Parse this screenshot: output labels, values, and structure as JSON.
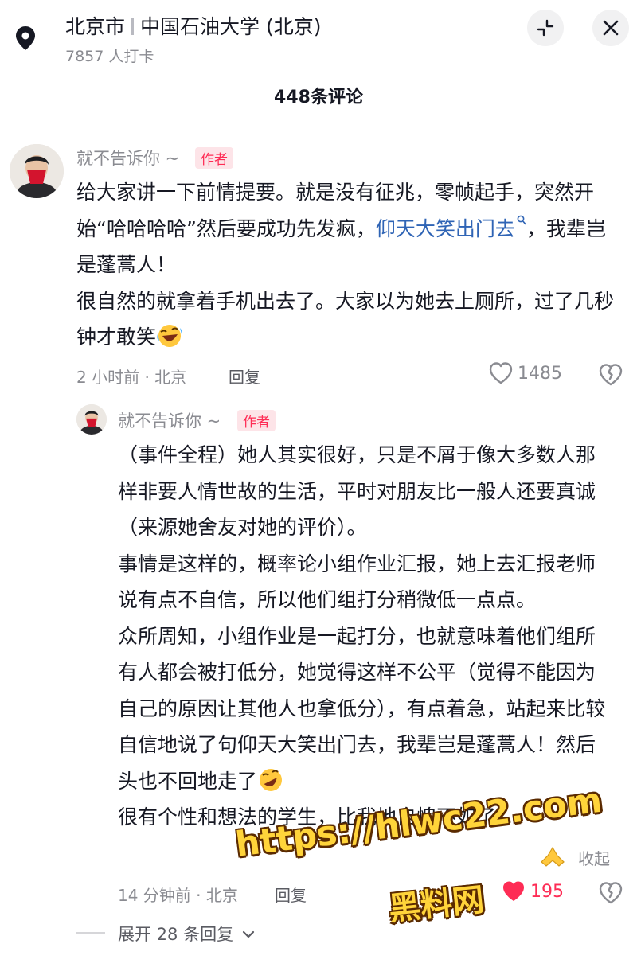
{
  "header": {
    "city": "北京市",
    "place": "中国石油大学 (北京)",
    "checkins": "7857 人打卡",
    "icons": {
      "location": "location-pin-icon",
      "collapse": "collapse-icon",
      "close": "close-icon"
    }
  },
  "comments_title": "448条评论",
  "top_comment": {
    "username": "就不告诉你 ~",
    "badge": "作者",
    "text": {
      "part1": "给大家讲一下前情提要。就是没有征兆，零帧起手，突然开始“哈哈哈哈”然后要成功先发疯，",
      "link": "仰天大笑出门去",
      "part2": "，我辈岂是蓬蒿人！",
      "line2": "很自然的就拿着手机出去了。大家以为她去上厕所，过了几秒钟才敢笑"
    },
    "time_location": "2 小时前 · 北京",
    "reply_label": "回复",
    "likes": "1485",
    "liked": false
  },
  "reply_comment": {
    "username": "就不告诉你 ~",
    "badge": "作者",
    "paragraphs": [
      "（事件全程）她人其实很好，只是不屑于像大多数人那样非要人情世故的生活，平时对朋友比一般人还要真诚（来源她舍友对她的评价）。",
      "事情是这样的，概率论小组作业汇报，她上去汇报老师说有点不自信，所以他们组打分稍微低一点点。",
      "众所周知，小组作业是一起打分，也就意味着他们组所有人都会被打低分，她觉得这样不公平（觉得不能因为自己的原因让其他人也拿低分），有点着急，站起来比较自信地说了句仰天大笑出门去，我辈岂是蓬蒿人！然后头也不回地走了",
      "很有个性和想法的学生，比我地自愧不如了"
    ],
    "collapse_label": "收起",
    "time_location": "14 分钟前 · 北京",
    "reply_label": "回复",
    "likes": "195",
    "liked": true
  },
  "expand_replies": "展开 28 条回复",
  "watermark": {
    "url": "https://hlwc22.com",
    "site": "黑料网"
  },
  "colors": {
    "accent": "#fe2c55",
    "link": "#2f64b5",
    "muted": "#8a8b91",
    "watermark": "#ffd43a"
  }
}
